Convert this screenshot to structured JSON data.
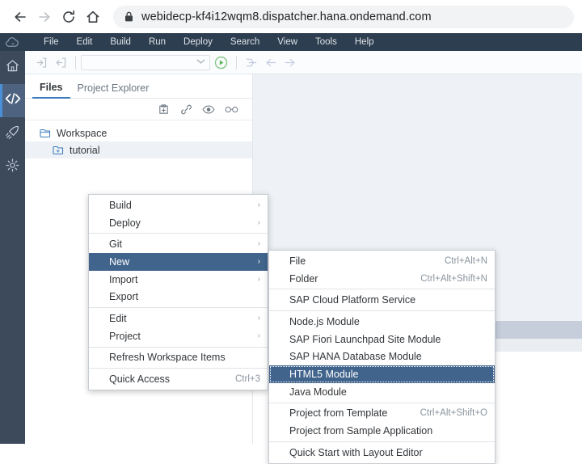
{
  "browser": {
    "back_icon": "arrow-left-icon",
    "forward_icon": "arrow-right-icon",
    "reload_icon": "reload-icon",
    "home_icon": "home-icon",
    "lock_icon": "lock-icon",
    "url": "webidecp-kf4i12wqm8.dispatcher.hana.ondemand.com"
  },
  "rail": {
    "logo_icon": "sap-cloud-logo-icon",
    "items": [
      {
        "name": "home",
        "icon": "home-icon",
        "active": false
      },
      {
        "name": "development",
        "icon": "code-brackets-icon",
        "active": true
      },
      {
        "name": "deploy",
        "icon": "rocket-icon",
        "active": false
      },
      {
        "name": "preferences",
        "icon": "gear-icon",
        "active": false
      }
    ]
  },
  "menubar": {
    "items": [
      "File",
      "Edit",
      "Build",
      "Run",
      "Deploy",
      "Search",
      "View",
      "Tools",
      "Help"
    ]
  },
  "toolbar": {
    "import_icon": "import-icon",
    "export_icon": "export-icon",
    "run_config_value": "",
    "run_config_caret": "chevron-down-icon",
    "run_icon": "run-play-icon",
    "nav_icons": [
      "merge-icon",
      "arrow-back-icon",
      "arrow-forward-icon"
    ]
  },
  "explorer": {
    "tabs": [
      {
        "label": "Files",
        "active": true
      },
      {
        "label": "Project Explorer",
        "active": false
      }
    ],
    "tools": [
      {
        "name": "new-file",
        "icon": "new-file-icon"
      },
      {
        "name": "link",
        "icon": "link-icon"
      },
      {
        "name": "preview",
        "icon": "eye-icon"
      },
      {
        "name": "watch",
        "icon": "glasses-icon"
      }
    ],
    "tree": [
      {
        "label": "Workspace",
        "icon": "folder-open-icon",
        "level": 1,
        "selected": false
      },
      {
        "label": "tutorial",
        "icon": "folder-project-icon",
        "level": 2,
        "selected": true
      }
    ]
  },
  "context_menu": {
    "items": [
      {
        "label": "Build",
        "shortcut": "",
        "submenu": true,
        "state": "normal",
        "separator_after": false
      },
      {
        "label": "Deploy",
        "shortcut": "",
        "submenu": true,
        "state": "normal",
        "separator_after": true
      },
      {
        "label": "Git",
        "shortcut": "",
        "submenu": true,
        "state": "normal",
        "separator_after": false
      },
      {
        "label": "New",
        "shortcut": "",
        "submenu": true,
        "state": "highlight",
        "separator_after": false
      },
      {
        "label": "Import",
        "shortcut": "",
        "submenu": true,
        "state": "normal",
        "separator_after": false
      },
      {
        "label": "Export",
        "shortcut": "",
        "submenu": false,
        "state": "normal",
        "separator_after": true
      },
      {
        "label": "Edit",
        "shortcut": "",
        "submenu": true,
        "state": "normal",
        "separator_after": false
      },
      {
        "label": "Project",
        "shortcut": "",
        "submenu": true,
        "state": "normal",
        "separator_after": true
      },
      {
        "label": "Refresh Workspace Items",
        "shortcut": "",
        "submenu": false,
        "state": "normal",
        "separator_after": true
      },
      {
        "label": "Quick Access",
        "shortcut": "Ctrl+3",
        "submenu": false,
        "state": "normal",
        "separator_after": false
      }
    ]
  },
  "submenu": {
    "items": [
      {
        "label": "File",
        "shortcut": "Ctrl+Alt+N",
        "state": "normal",
        "separator_after": false
      },
      {
        "label": "Folder",
        "shortcut": "Ctrl+Alt+Shift+N",
        "state": "normal",
        "separator_after": true
      },
      {
        "label": "SAP Cloud Platform Service",
        "shortcut": "",
        "state": "normal",
        "separator_after": true
      },
      {
        "label": "Node.js Module",
        "shortcut": "",
        "state": "normal",
        "separator_after": false
      },
      {
        "label": "SAP Fiori Launchpad Site Module",
        "shortcut": "",
        "state": "normal",
        "separator_after": false
      },
      {
        "label": "SAP HANA Database Module",
        "shortcut": "",
        "state": "normal",
        "separator_after": false
      },
      {
        "label": "HTML5 Module",
        "shortcut": "",
        "state": "focus",
        "separator_after": false
      },
      {
        "label": "Java Module",
        "shortcut": "",
        "state": "normal",
        "separator_after": true
      },
      {
        "label": "Project from Template",
        "shortcut": "Ctrl+Alt+Shift+O",
        "state": "normal",
        "separator_after": false
      },
      {
        "label": "Project from Sample Application",
        "shortcut": "",
        "state": "normal",
        "separator_after": true
      },
      {
        "label": "Quick Start with Layout Editor",
        "shortcut": "",
        "state": "normal",
        "separator_after": false
      }
    ]
  },
  "colors": {
    "menubar_bg": "#2d3e50",
    "rail_bg": "#3d4a5c",
    "rail_active": "#4d6380",
    "menu_highlight": "#41648c",
    "tab_underline": "#3b7bbf",
    "run_green": "#5cb85c",
    "editor_bg": "#eef1f5"
  }
}
